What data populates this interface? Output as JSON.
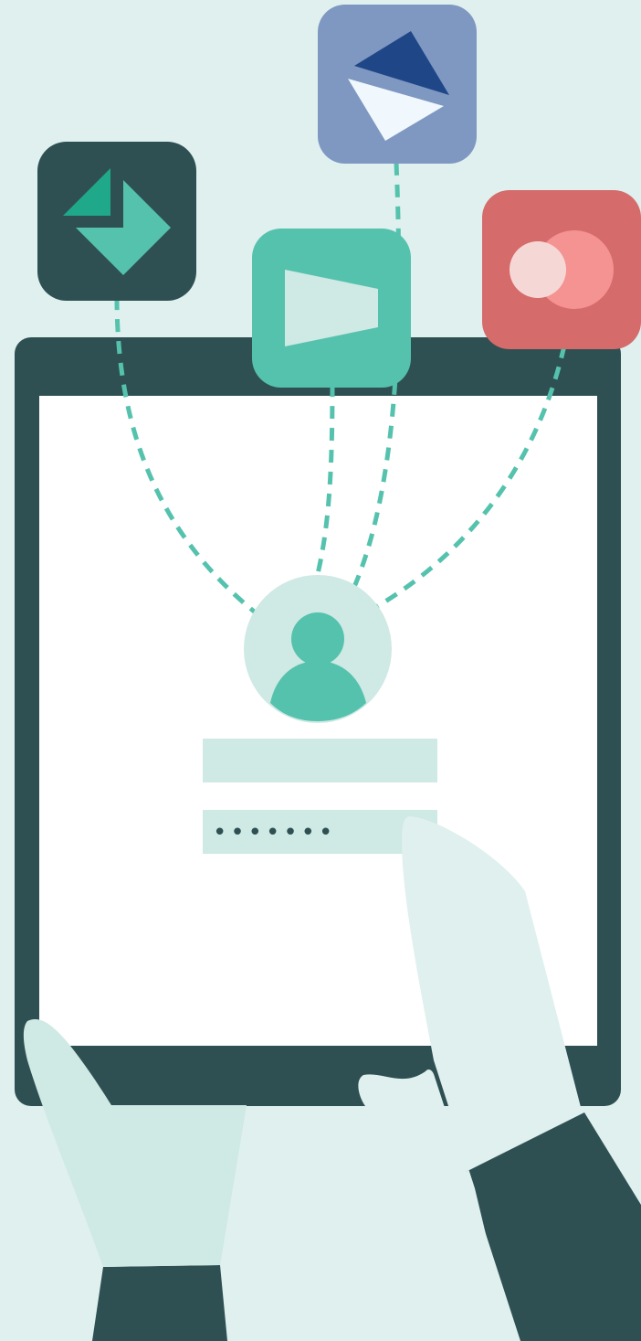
{
  "colors": {
    "background": "#dff0ef",
    "dark_teal": "#2e5052",
    "teal": "#55c2ad",
    "pale_teal": "#cfe9e4",
    "white": "#ffffff",
    "slate_blue": "#7f98c1",
    "navy": "#1f4788",
    "coral": "#d56b6a",
    "pink": "#f49391",
    "pale_pink": "#f5d8d5",
    "hand": "#dff0ef"
  },
  "login_form": {
    "username_value": "",
    "password_masked": "•••••••"
  },
  "icons": [
    {
      "name": "green-app-icon"
    },
    {
      "name": "blue-app-icon"
    },
    {
      "name": "teal-app-icon"
    },
    {
      "name": "red-app-icon"
    }
  ]
}
